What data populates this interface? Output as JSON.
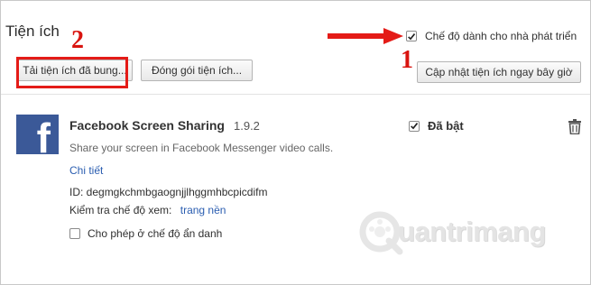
{
  "header": {
    "title": "Tiện ích",
    "developer_mode": {
      "label": "Chế độ dành cho nhà phát triển",
      "checked": true
    }
  },
  "toolbar": {
    "load_unpacked_label": "Tải tiện ích đã bung...",
    "pack_label": "Đóng gói tiện ích...",
    "update_label": "Cập nhật tiện ích ngay bây giờ"
  },
  "annotations": {
    "step1": "1",
    "step2": "2",
    "color": "#e41b17"
  },
  "extension": {
    "icon": "facebook-logo-icon",
    "icon_letter": "f",
    "icon_color": "#3b5998",
    "name": "Facebook Screen Sharing",
    "version": "1.9.2",
    "description": "Share your screen in Facebook Messenger video calls.",
    "details_link": "Chi tiết",
    "id_text": "ID: degmgkchmbgaognjjlhggmhbcpicdifm",
    "inspect_label": "Kiểm tra chế độ xem:",
    "inspect_link": "trang nền",
    "incognito_label": "Cho phép ở chế độ ẩn danh",
    "incognito_checked": false,
    "enabled_label": "Đã bật",
    "enabled_checked": true,
    "remove_icon": "trash-icon"
  },
  "watermark": {
    "text": "uantrimang"
  }
}
